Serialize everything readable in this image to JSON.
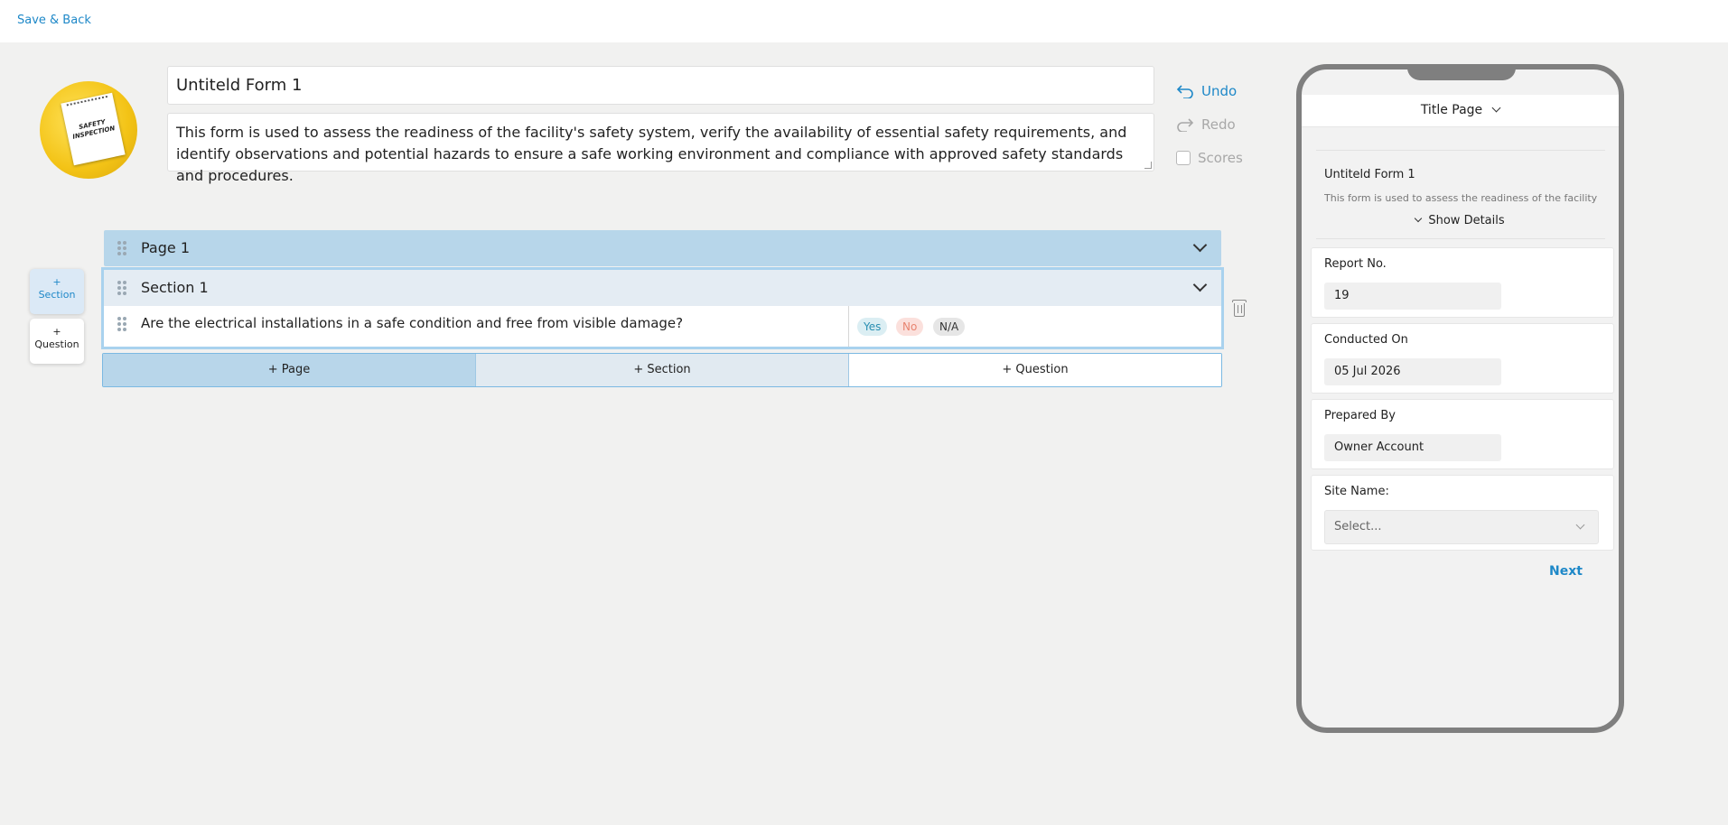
{
  "topbar": {
    "save_back": "Save & Back"
  },
  "logo": {
    "text": "SAFETY INSPECTION"
  },
  "form": {
    "title": "Untiteld Form 1",
    "description": "This form is used to assess the readiness of the facility's safety system, verify the availability of essential safety requirements, and identify observations and potential hazards to ensure a safe working environment and compliance with approved safety standards and procedures."
  },
  "toolbar": {
    "undo": "Undo",
    "redo": "Redo",
    "scores": "Scores"
  },
  "side_buttons": {
    "section": "+\nSection",
    "question": "+\nQuestion",
    "section_plus": "+",
    "section_label": "Section",
    "question_plus": "+",
    "question_label": "Question"
  },
  "builder": {
    "page_label": "Page 1",
    "section_label": "Section 1",
    "question": "Are the electrical installations in a safe condition and free from visible damage?",
    "responses": {
      "yes": "Yes",
      "no": "No",
      "na": "N/A"
    },
    "add_page": "+ Page",
    "add_section": "+ Section",
    "add_question": "+ Question"
  },
  "preview": {
    "header": "Title Page",
    "form_title": "Untiteld Form 1",
    "form_desc": "This form is used to assess the readiness of the facility's safety system",
    "show_details": "Show Details",
    "fields": {
      "report_label": "Report No.",
      "report_value": "19",
      "conducted_label": "Conducted On",
      "conducted_value": "05 Jul 2026",
      "prepared_label": "Prepared By",
      "prepared_value": "Owner Account",
      "site_label": "Site Name:",
      "site_placeholder": "Select..."
    },
    "next": "Next"
  },
  "colors": {
    "accent": "#1e88c8",
    "page_row": "#b7d6ea",
    "section_row": "#e4ecf3"
  }
}
